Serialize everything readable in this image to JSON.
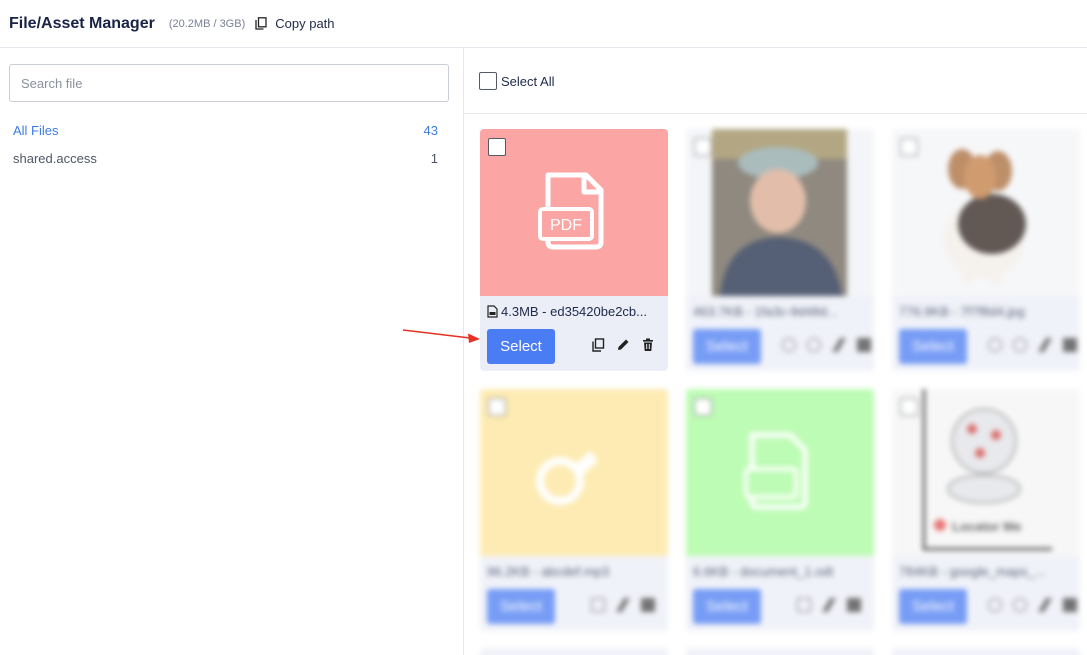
{
  "header": {
    "title": "File/Asset Manager",
    "storage": "(20.2MB / 3GB)",
    "copy_path_label": "Copy path"
  },
  "sidebar": {
    "search_placeholder": "Search file",
    "items": [
      {
        "label": "All Files",
        "count": "43"
      },
      {
        "label": "shared.access",
        "count": "1"
      }
    ]
  },
  "toolbar": {
    "select_all_label": "Select All"
  },
  "files": [
    {
      "meta": "4.3MB - ed35420be2cb...",
      "type_label": "PDF",
      "select_label": "Select",
      "thumb_color": "#fca5a5"
    },
    {
      "meta": "463.7KB - 1fa3c-9d48d...",
      "select_label": "Select",
      "thumb_color": "#f1f2f6"
    },
    {
      "meta": "776.9KB - 7f7f8d4.jpg",
      "select_label": "Select",
      "thumb_color": "#f4f5f7"
    },
    {
      "meta": "96.2KB - abcdef.mp3",
      "select_label": "Select",
      "thumb_color": "#fde59a"
    },
    {
      "meta": "6.6KB - document_1.odt",
      "select_label": "Select",
      "thumb_color": "#a8fb9c"
    },
    {
      "meta": "784KB - google_maps_...",
      "select_label": "Select",
      "thumb_color": "#f5f5f5",
      "map_label": "Locator Me"
    }
  ],
  "colors": {
    "accent": "#4a7cf3",
    "active_link": "#3d7be0",
    "pdf_thumb": "#fca5a5",
    "audio_thumb": "#fde59a",
    "doc_thumb": "#a8fb9c",
    "annotation_arrow": "#e53224"
  },
  "icons": [
    "copy-icon",
    "edit-icon",
    "trash-icon",
    "file-icon",
    "pdf-icon",
    "audio-file-icon",
    "document-icon"
  ]
}
